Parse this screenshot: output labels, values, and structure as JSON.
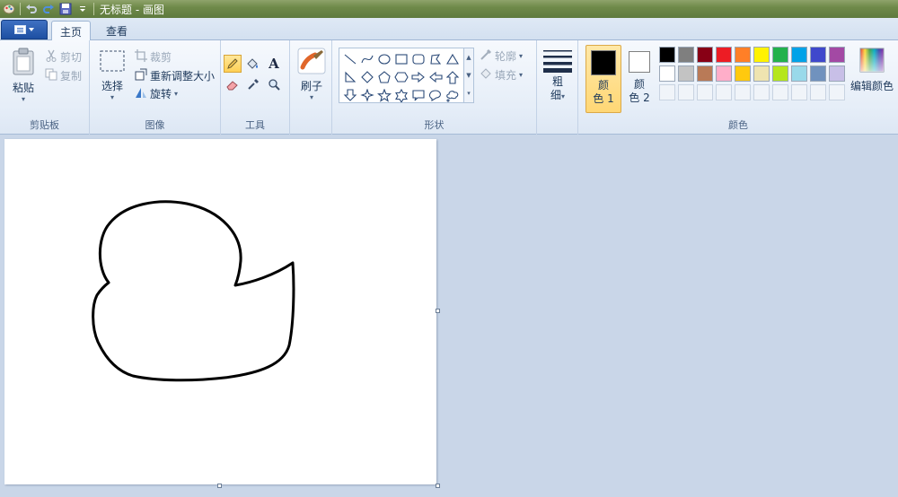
{
  "window": {
    "title": "无标题 - 画图"
  },
  "tabs": {
    "file_icon": "menu-icon",
    "home": "主页",
    "view": "查看"
  },
  "clipboard": {
    "paste": "粘贴",
    "cut": "剪切",
    "copy": "复制",
    "group": "剪贴板"
  },
  "image": {
    "select": "选择",
    "crop": "裁剪",
    "resize": "重新调整大小",
    "rotate": "旋转",
    "group": "图像"
  },
  "tools": {
    "group": "工具",
    "icons": [
      "pencil-icon",
      "fill-icon",
      "text-icon",
      "eraser-icon",
      "color-picker-icon",
      "magnifier-icon"
    ]
  },
  "brushes": {
    "label": "刷子"
  },
  "shapes": {
    "group": "形状",
    "outline": "轮廓",
    "fill": "填充"
  },
  "size": {
    "label_1": "粗",
    "label_2": "细"
  },
  "colors": {
    "group": "颜色",
    "color1_label_1": "颜",
    "color1_label_2": "色 1",
    "color2_label_1": "颜",
    "color2_label_2": "色 2",
    "color1": "#000000",
    "color2": "#ffffff",
    "edit": "编辑颜色",
    "palette_row1": [
      "#000000",
      "#7f7f7f",
      "#880015",
      "#ed1c24",
      "#ff7f27",
      "#fff200",
      "#22b14c",
      "#00a2e8",
      "#3f48cc",
      "#a349a4"
    ],
    "palette_row2": [
      "#ffffff",
      "#c3c3c3",
      "#b97a57",
      "#ffaec9",
      "#ffc90e",
      "#efe4b0",
      "#b5e61d",
      "#99d9ea",
      "#7092be",
      "#c8bfe7"
    ]
  },
  "accent": {
    "active_highlight": "#ffd055",
    "ribbon_text": "#1e395b"
  }
}
